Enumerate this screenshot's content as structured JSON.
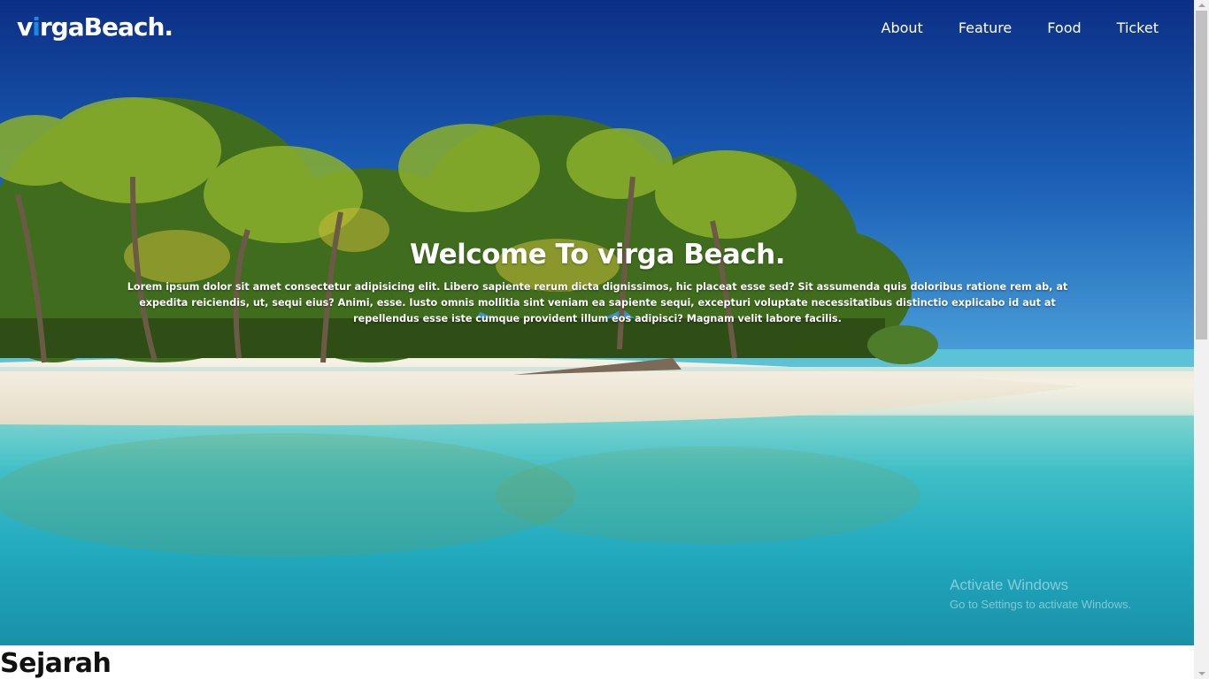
{
  "header": {
    "logo_prefix": "v",
    "logo_accent": "i",
    "logo_rest": "rgaBeach.",
    "nav": [
      "About",
      "Feature",
      "Food",
      "Ticket"
    ]
  },
  "hero": {
    "title": "Welcome To virga Beach.",
    "text": "Lorem ipsum dolor sit amet consectetur adipisicing elit. Libero sapiente rerum dicta dignissimos, hic placeat esse sed? Sit assumenda quis doloribus ratione rem ab, at expedita reiciendis, ut, sequi eius? Animi, esse. Iusto omnis mollitia sint veniam ea sapiente sequi, excepturi voluptate necessitatibus distinctio explicabo id aut at repellendus esse iste cumque provident illum eos adipisci? Magnam velit labore facilis."
  },
  "section": {
    "heading": "Sejarah"
  },
  "watermark": {
    "line1": "Activate Windows",
    "line2": "Go to Settings to activate Windows."
  },
  "colors": {
    "accent": "#1e88e5",
    "nav_text": "#ffffff",
    "scrollbar_track": "#f1f1f1",
    "scrollbar_thumb": "#c1c1c1"
  }
}
